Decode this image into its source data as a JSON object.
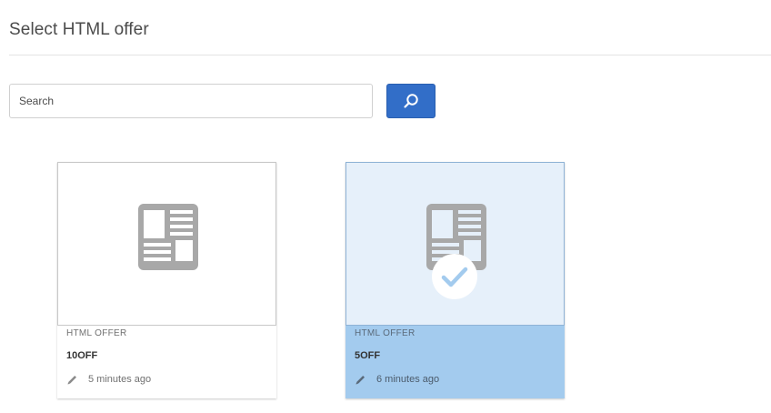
{
  "page": {
    "title": "Select HTML offer"
  },
  "search": {
    "placeholder": "Search",
    "value": "",
    "button_icon": "search-icon",
    "button_color": "#326ec8"
  },
  "offers": [
    {
      "type_label": "HTML OFFER",
      "name": "10OFF",
      "modified": "5 minutes ago",
      "selected": false,
      "thumbnail_icon": "document-layout-icon"
    },
    {
      "type_label": "HTML OFFER",
      "name": "5OFF",
      "modified": "6 minutes ago",
      "selected": true,
      "thumbnail_icon": "document-layout-icon",
      "selection_color": "#a3cbee"
    }
  ]
}
